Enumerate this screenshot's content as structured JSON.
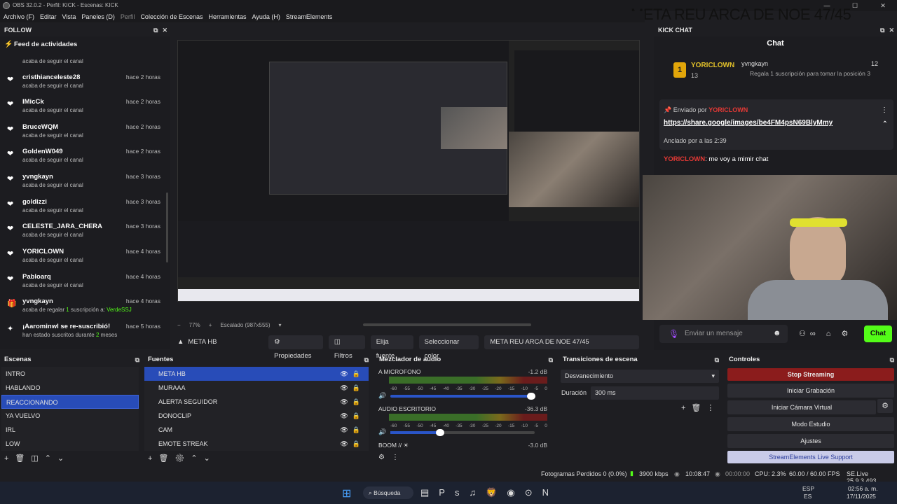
{
  "window": {
    "title": "OBS 32.0.2 - Perfil: KICK - Escenas: KICK",
    "controls": [
      "—",
      "☐",
      "✕"
    ]
  },
  "overlay_title": "META REU ARCA DE NOE 47/45",
  "menu": [
    "Archivo (F)",
    "Editar",
    "Vista",
    "Paneles (D)",
    "Perfil",
    "Colección de Escenas",
    "Herramientas",
    "Ayuda (H)",
    "StreamElements"
  ],
  "follow_dock": {
    "title": "FOLLOW",
    "feed_title": "Feed de actividades",
    "top_sub": "acaba de seguir el canal",
    "items": [
      {
        "name": "cristhianceleste28",
        "time": "hace 2 horas",
        "sub": "acaba de seguir el canal"
      },
      {
        "name": "IMicCk",
        "time": "hace 2 horas",
        "sub": "acaba de seguir el canal"
      },
      {
        "name": "BruceWQM",
        "time": "hace 2 horas",
        "sub": "acaba de seguir el canal"
      },
      {
        "name": "GoldenW049",
        "time": "hace 2 horas",
        "sub": "acaba de seguir el canal"
      },
      {
        "name": "yvngkayn",
        "time": "hace 3 horas",
        "sub": "acaba de seguir el canal"
      },
      {
        "name": "goldizzi",
        "time": "hace 3 horas",
        "sub": "acaba de seguir el canal"
      },
      {
        "name": "CELESTE_JARA_CHERA",
        "time": "hace 3 horas",
        "sub": "acaba de seguir el canal"
      },
      {
        "name": "YORICLOWN",
        "time": "hace 4 horas",
        "sub": "acaba de seguir el canal"
      },
      {
        "name": "Pabloarq",
        "time": "hace 4 horas",
        "sub": "acaba de seguir el canal"
      }
    ],
    "gift": {
      "name": "yvngkayn",
      "time": "hace 4 horas",
      "sub_a": "acaba de regalar",
      "count": "1",
      "sub_b": "suscripción a:",
      "target": "VerdeSSJ"
    },
    "resub": {
      "name": "¡Aarominwl se re-suscribió!",
      "time": "hace 5 horas",
      "sub_a": "han estado suscritos durante",
      "months": "2",
      "sub_b": "meses"
    }
  },
  "scale": {
    "zoom": "77%",
    "mode": "Escalado (987x555)"
  },
  "source_toolbar": {
    "source": "META HB",
    "buttons": [
      "Propiedades",
      "Filtros",
      "Elija fuente",
      "Seleccionar color"
    ],
    "text": "META REU ARCA DE NOE 47/45"
  },
  "chat": {
    "dock_title": "KICK CHAT",
    "title": "Chat",
    "gift_user": "YORICLOWN",
    "gift_count": "13",
    "gifter": "yvngkayn",
    "gifter_count": "12",
    "gift_text": "Regala 1 suscripción para tomar la posición 3",
    "pinned_by_label": "Enviado por",
    "pinned_user": "YORICLOWN",
    "link": "https://share.google/images/be4FM4psN69BlyMmy",
    "anchored_label": "Anclado por",
    "anchored_time": "a las 2:39",
    "msg_user": "YORICLOWN",
    "msg_text": ": me voy a mimir chat",
    "input_placeholder": "Enviar un mensaje",
    "send_label": "Chat"
  },
  "scenes": {
    "title": "Escenas",
    "items": [
      "INTRO",
      "HABLANDO",
      "REACCIONANDO",
      "YA VUELVO",
      "IRL",
      "LOW"
    ],
    "selected": 2
  },
  "sources": {
    "title": "Fuentes",
    "items": [
      "META HB",
      "MURAAA",
      "ALERTA SEGUIDOR",
      "DONOCLIP",
      "CAM",
      "EMOTE STREAK"
    ],
    "selected": 0
  },
  "mixer": {
    "title": "Mezclador de audio",
    "channels": [
      {
        "name": "A MICROFONO",
        "db": "-1.2 dB",
        "level": 0.78
      },
      {
        "name": "AUDIO ESCRITORIO",
        "db": "-36.3 dB",
        "level": 0.35
      },
      {
        "name": "BOOM // ☀",
        "db": "-3.0 dB",
        "level": 0.0
      }
    ],
    "scale": [
      "-60",
      "-55",
      "-50",
      "-45",
      "-40",
      "-35",
      "-30",
      "-25",
      "-20",
      "-15",
      "-10",
      "-5",
      "0"
    ]
  },
  "transitions": {
    "title": "Transiciones de escena",
    "selected": "Desvanecimiento",
    "duration_label": "Duración",
    "duration": "300 ms"
  },
  "controls": {
    "title": "Controles",
    "buttons": [
      "Stop Streaming",
      "Iniciar Grabación",
      "Iniciar Cámara Virtual",
      "Modo Estudio",
      "Ajustes",
      "StreamElements Live Support"
    ]
  },
  "status": {
    "frames": "Fotogramas Perdidos 0 (0.0%)",
    "bitrate": "3900 kbps",
    "live_time": "10:08:47",
    "rec_time": "00:00:00",
    "cpu": "CPU: 2.3%",
    "fps": "60.00 / 60.00 FPS",
    "se": "SE.Live 25.9.3.493"
  },
  "taskbar": {
    "search": "Búsqueda",
    "lang": "ESP",
    "lang2": "ES",
    "time": "02:56 a. m.",
    "date": "17/11/2025"
  },
  "colors": {
    "kick_green": "#53fc18",
    "selection": "#284cb8",
    "stop_red": "#8b1c1c"
  }
}
